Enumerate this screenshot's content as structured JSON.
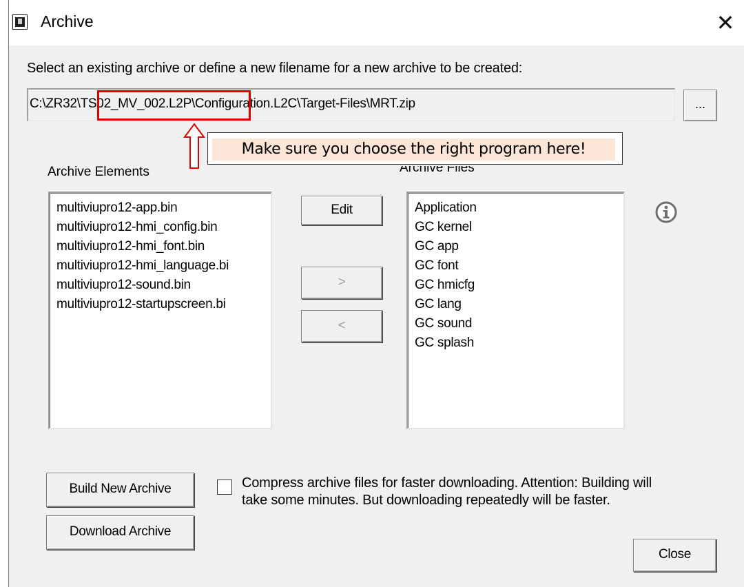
{
  "window": {
    "title": "Archive",
    "close_glyph": "✕",
    "icon": "archive-app-icon"
  },
  "instruction": "Select an existing archive or define a new filename for a new archive to be created:",
  "path": {
    "value": "C:\\ZR32\\TS02_MV_002.L2P\\Configuration.L2C\\Target-Files\\MRT.zip",
    "highlighted_segment": "TS02_MV_002.L2P\\",
    "browse_label": "..."
  },
  "annotation": {
    "callout_text": "Make sure you choose the right program here!",
    "highlight_color": "#e00000",
    "callout_fill": "#fbe5d6"
  },
  "archive_elements": {
    "label": "Archive Elements",
    "items": [
      "multiviupro12-app.bin",
      "multiviupro12-hmi_config.bin",
      "multiviupro12-hmi_font.bin",
      "multiviupro12-hmi_language.bi",
      "multiviupro12-sound.bin",
      "multiviupro12-startupscreen.bi"
    ]
  },
  "archive_files": {
    "label": "Archive Files",
    "items": [
      "Application",
      "GC kernel",
      "GC app",
      "GC font",
      "GC hmicfg",
      "GC lang",
      "GC sound",
      "GC splash"
    ]
  },
  "buttons": {
    "edit": "Edit",
    "move_right": ">",
    "move_left": "<",
    "build": "Build New Archive",
    "download": "Download Archive",
    "close": "Close"
  },
  "compress": {
    "checked": false,
    "line1": "Compress archive files for faster downloading. Attention: Building will",
    "line2": "take some minutes. But downloading repeatedly will be faster."
  },
  "info_icon": "info-circle-icon"
}
